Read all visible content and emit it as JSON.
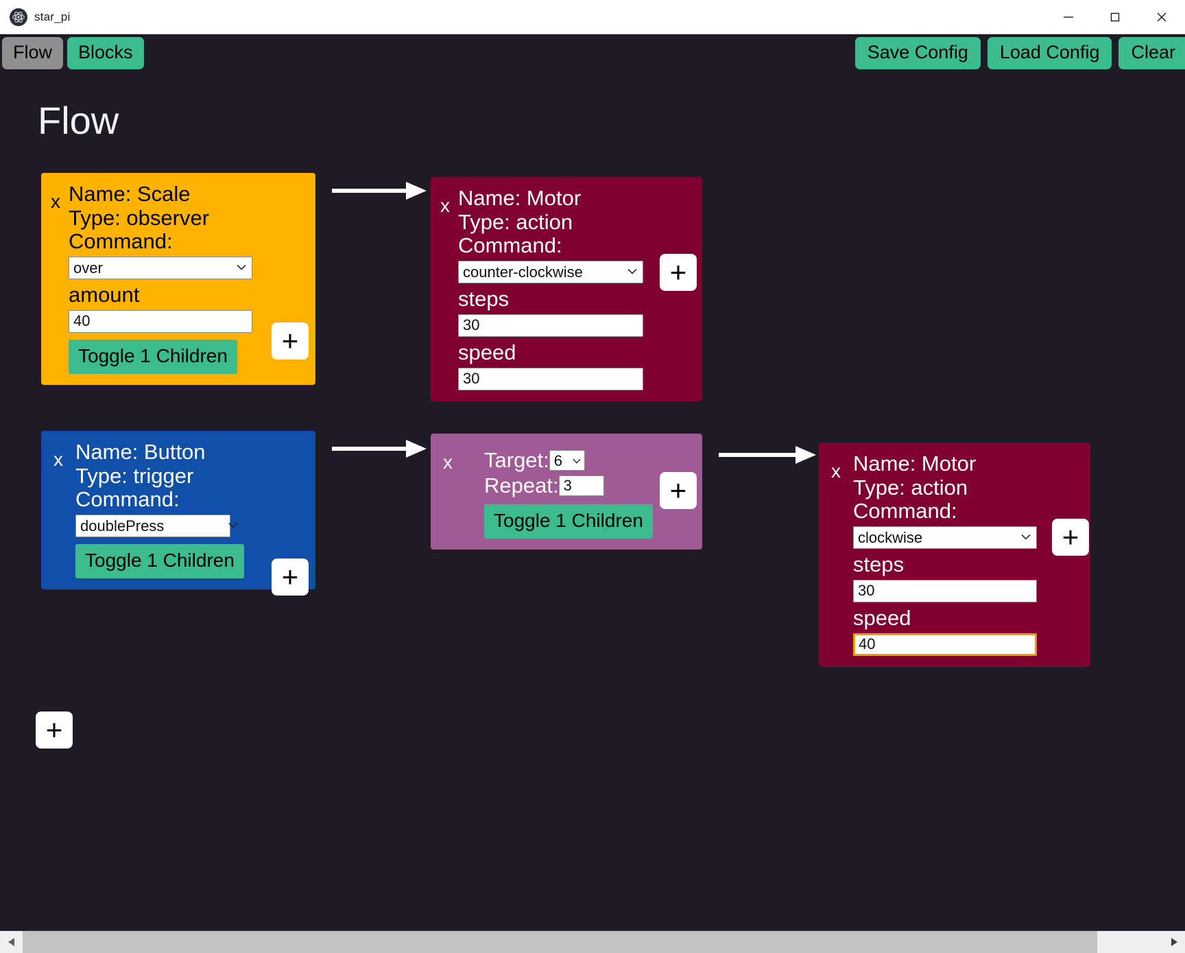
{
  "window": {
    "title": "star_pi",
    "icon": "electron-atom-icon",
    "controls": {
      "minimize": "minimize-icon",
      "maximize": "maximize-icon",
      "close": "close-icon"
    }
  },
  "toolbar": {
    "tabs": [
      {
        "label": "Flow",
        "state": "inactive"
      },
      {
        "label": "Blocks",
        "state": "active"
      }
    ],
    "actions": [
      {
        "label": "Save Config"
      },
      {
        "label": "Load Config"
      },
      {
        "label": "Clear"
      }
    ]
  },
  "canvas": {
    "heading": "Flow",
    "add_node_button": "+",
    "nodes": [
      {
        "id": "scale-observer",
        "close_label": "x",
        "name_line": "Name: Scale",
        "type_line": "Type: observer",
        "command_label": "Command:",
        "command_value": "over",
        "param_label": "amount",
        "param_value": "40",
        "toggle_label": "Toggle 1 Children",
        "add_label": "+",
        "color": "#ffb300"
      },
      {
        "id": "motor-action-top",
        "close_label": "x",
        "name_line": "Name: Motor",
        "type_line": "Type: action",
        "command_label": "Command:",
        "command_value": "counter-clockwise",
        "param1_label": "steps",
        "param1_value": "30",
        "param2_label": "speed",
        "param2_value": "30",
        "add_label": "+",
        "color": "#800030"
      },
      {
        "id": "button-trigger",
        "close_label": "x",
        "name_line": "Name: Button",
        "type_line": "Type: trigger",
        "command_label": "Command:",
        "command_value": "doublePress",
        "toggle_label": "Toggle 1 Children",
        "add_label": "+",
        "color": "#1050a8"
      },
      {
        "id": "target-repeat",
        "close_label": "x",
        "target_label": "Target:",
        "target_value": "6",
        "repeat_label": "Repeat:",
        "repeat_value": "3",
        "toggle_label": "Toggle 1 Children",
        "add_label": "+",
        "color": "#a05a96"
      },
      {
        "id": "motor-action-bottom",
        "close_label": "x",
        "name_line": "Name: Motor",
        "type_line": "Type: action",
        "command_label": "Command:",
        "command_value": "clockwise",
        "param1_label": "steps",
        "param1_value": "30",
        "param2_label": "speed",
        "param2_value": "40",
        "param2_focused": true,
        "add_label": "+",
        "color": "#800030"
      }
    ]
  },
  "scrollbar": {
    "left_arrow": "scroll-left-icon",
    "right_arrow": "scroll-right-icon"
  },
  "colors": {
    "background": "#1e1b26",
    "accent_green": "#3cbc8d",
    "focus_outline": "#e0a306",
    "observer": "#ffb300",
    "action": "#800030",
    "trigger": "#1050a8",
    "loop": "#a05a96"
  }
}
